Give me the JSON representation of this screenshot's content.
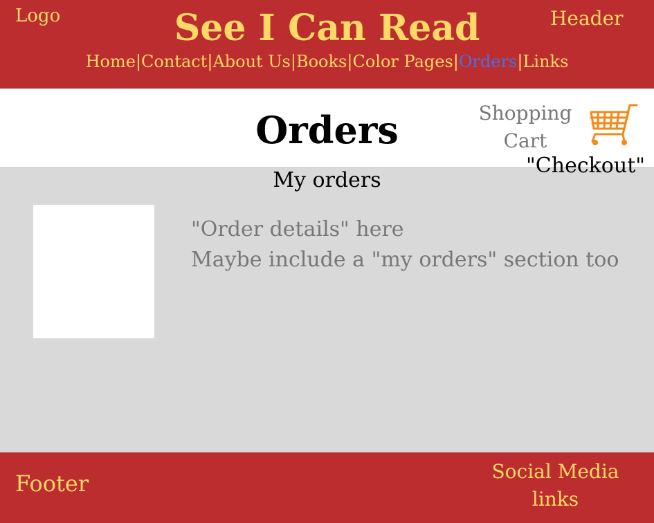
{
  "header": {
    "logo": "Logo",
    "label": "Header",
    "site_title": "See I Can Read",
    "nav": [
      {
        "label": "Home",
        "active": false
      },
      {
        "label": "Contact",
        "active": false
      },
      {
        "label": "About Us",
        "active": false
      },
      {
        "label": "Books",
        "active": false
      },
      {
        "label": "Color Pages",
        "active": false
      },
      {
        "label": "Orders",
        "active": true
      },
      {
        "label": "Links",
        "active": false
      }
    ],
    "separator": "|"
  },
  "page": {
    "title": "Orders",
    "cart_label_line1": "Shopping",
    "cart_label_line2": "Cart",
    "checkout": "\"Checkout\"",
    "section_title": "My orders",
    "details_line1": "\"Order details\" here",
    "details_line2": "Maybe include a \"my orders\" section too"
  },
  "footer": {
    "label": "Footer",
    "social_line1": "Social Media",
    "social_line2": "links"
  },
  "colors": {
    "brand_red": "#bb2d2e",
    "brand_yellow": "#ffd966",
    "active_link": "#4a6fe3",
    "content_bg": "#d9d9d9",
    "cart_orange": "#f28a1a"
  },
  "icons": {
    "cart": "shopping-cart-icon"
  }
}
